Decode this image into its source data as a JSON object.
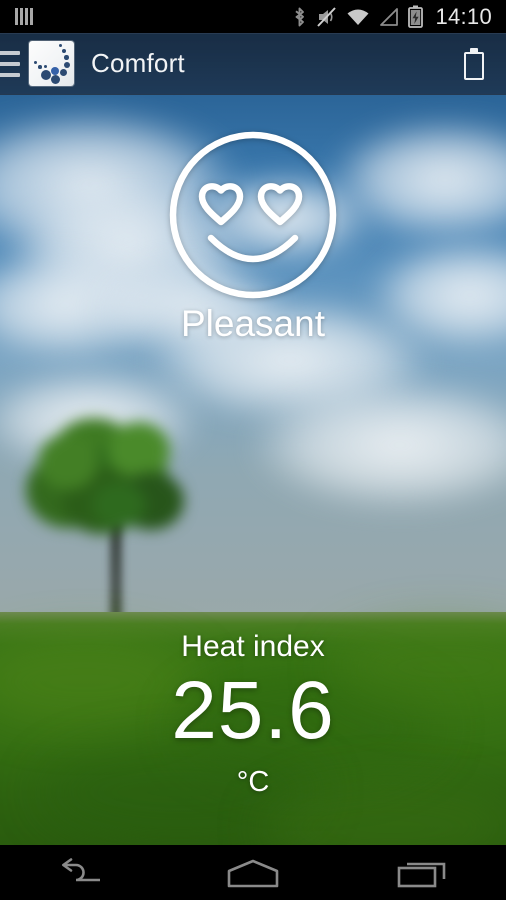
{
  "status_bar": {
    "sim_icon": "sim-signal-bars-icon",
    "bluetooth_icon": "bluetooth-icon",
    "sound_icon": "volume-muted-icon",
    "wifi_icon": "wifi-icon",
    "cell_signal_icon": "cell-signal-icon",
    "battery_icon": "battery-charging-icon",
    "time": "14:10"
  },
  "action_bar": {
    "drawer_icon": "hamburger-menu-icon",
    "app_logo_icon": "app-logo-icon",
    "title": "Comfort",
    "battery_icon": "battery-icon"
  },
  "main": {
    "comfort_face_icon": "smiley-heart-eyes-icon",
    "comfort_label": "Pleasant",
    "readout_label": "Heat index",
    "readout_value": "25.6",
    "readout_unit": "°C"
  },
  "nav_bar": {
    "back_icon": "back-arrow-icon",
    "home_icon": "home-icon",
    "recents_icon": "recent-apps-icon"
  },
  "colors": {
    "status_bar_bg": "#000000",
    "action_bar_bg": "#1a2e46",
    "sky_top": "#1b4a77",
    "sky_horizon": "#9aa9a8",
    "grass": "#357211",
    "text_primary": "#ffffff",
    "nav_icon": "#8a8a8a",
    "logo_dot": "#2c4a72"
  }
}
